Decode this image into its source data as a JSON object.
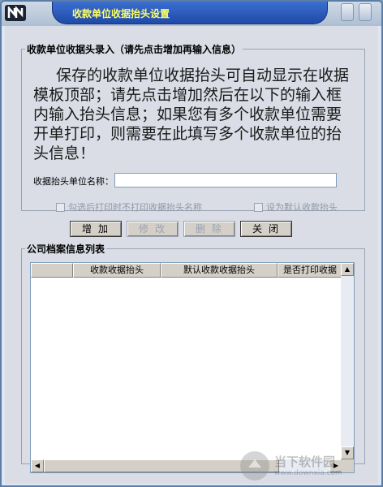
{
  "window": {
    "title": "收款单位收据抬头设置"
  },
  "section1": {
    "legend": "收款单位收据头录入（请先点击增加再输入信息）",
    "notice": "保存的收款单位收据抬头可自动显示在收据模板顶部；请先点击增加然后在以下的输入框内输入抬头信息；如果您有多个收款单位需要开单打印，则需要在此填写多个收款单位的抬头信息！",
    "name_label": "收据抬头单位名称：",
    "name_value": "",
    "checkbox_hide_label": "勾选后打印时不打印收据抬头名称",
    "checkbox_default_label": "设为默认收款抬头"
  },
  "buttons": {
    "add": "增加",
    "edit": "修改",
    "delete": "删除",
    "close": "关闭"
  },
  "section2": {
    "legend": "公司档案信息列表",
    "columns": [
      "",
      "收款收据抬头",
      "默认收款收据抬头",
      "是否打印收据"
    ]
  },
  "watermark": {
    "text": "当下软件园",
    "url": "www.downxia.com"
  }
}
